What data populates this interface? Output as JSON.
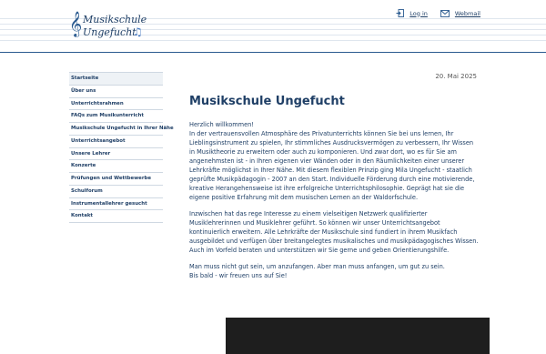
{
  "header": {
    "logo": {
      "line1": "Musikschule",
      "line2": "Ungefucht",
      "clef_icon": "treble-clef",
      "note_icon": "music-notes"
    },
    "links": [
      {
        "label": "Log in",
        "icon": "login-icon"
      },
      {
        "label": "Webmail",
        "icon": "mail-icon"
      }
    ]
  },
  "sidebar": {
    "items": [
      {
        "label": "Startseite",
        "active": true
      },
      {
        "label": "Über uns"
      },
      {
        "label": "Unterrichtsrahmen"
      },
      {
        "label": "FAQs zum Musikunterricht"
      },
      {
        "label": "Musikschule Ungefucht in Ihrer Nähe"
      },
      {
        "label": "Unterrichtsangebot"
      },
      {
        "label": "Unsere Lehrer"
      },
      {
        "label": "Konzerte"
      },
      {
        "label": "Prüfungen und Wettbewerbe"
      },
      {
        "label": "Schulforum"
      },
      {
        "label": "Instrumentallehrer gesucht"
      },
      {
        "label": "Kontakt"
      }
    ]
  },
  "main": {
    "date": "20. Mai 2025",
    "title": "Musikschule Ungefucht",
    "p1": "Herzlich willkommen!\nIn der vertrauensvollen Atmosphäre des Privatunterrichts können Sie bei uns lernen, Ihr Lieblingsinstrument zu spielen, Ihr stimmliches Ausdrucksvermögen zu verbessern, Ihr Wissen in Musiktheorie zu erweitern oder auch zu komponieren. Und zwar dort, wo es für Sie am angenehmsten ist - in Ihren eigenen vier Wänden oder in den Räumlichkeiten einer unserer Lehrkräfte möglichst in Ihrer Nähe. Mit diesem flexiblen Prinzip ging Mila Ungefucht - staatlich geprüfte Musikpädagogin - 2007 an den Start. Individuelle Förderung durch eine motivierende, kreative Herangehensweise ist ihre erfolgreiche Unterrichtsphilosophie. Geprägt hat sie die eigene positive Erfahrung mit dem musischen Lernen an der Waldorfschule.",
    "p2": "Inzwischen hat das rege Interesse zu einem vielseitigen Netzwerk qualifizierter Musiklehrerinnen und Musiklehrer geführt. So können wir unser Unterrichtsangebot kontinuierlich erweitern. Alle Lehrkräfte der Musikschule sind fundiert in ihrem Musikfach ausgebildet und verfügen über breitangelegtes musikalisches und musikpädagogisches Wissen. Auch im Vorfeld beraten und unterstützen wir Sie gerne und geben Orientierungshilfe.",
    "p3": "Man muss nicht gut sein, um anzufangen. Aber man muss anfangen, um gut zu sein.\nBis bald - wir freuen uns auf Sie!"
  },
  "colors": {
    "brand": "#1f3f66",
    "accent": "#2a5a8f",
    "video_bg": "#1e1e1e"
  }
}
